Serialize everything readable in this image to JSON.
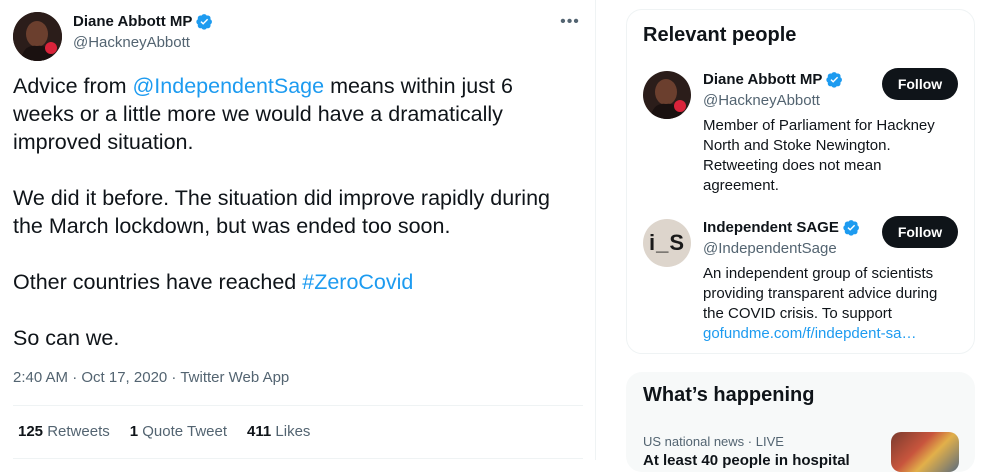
{
  "tweet": {
    "author_name": "Diane Abbott MP",
    "author_handle": "@HackneyAbbott",
    "more_icon": "more-horizontal-icon",
    "body": {
      "p1_before": "Advice from ",
      "p1_mention": "@IndependentSage",
      "p1_after": " means within just 6 weeks or a little more we would have a dramatically improved situation.",
      "p2": "We did it before. The situation did improve rapidly during the March lockdown, but was ended too soon.",
      "p3_before": "Other countries have reached ",
      "p3_hashtag": "#ZeroCovid",
      "p4": "So can we."
    },
    "meta": "2:40 AM · Oct 17, 2020 · Twitter Web App",
    "retweets_count": "125",
    "retweets_label": "Retweets",
    "quotes_count": "1",
    "quotes_label": "Quote Tweet",
    "likes_count": "411",
    "likes_label": "Likes"
  },
  "relevant_people": {
    "title": "Relevant people",
    "people": [
      {
        "name": "Diane Abbott MP",
        "handle": "@HackneyAbbott",
        "bio": "Member of Parliament for Hackney North and Stoke Newington. Retweeting does not mean agreement.",
        "follow_label": "Follow"
      },
      {
        "name": "Independent SAGE",
        "handle": "@IndependentSage",
        "bio_text": "An independent group of scientists providing transparent advice during the COVID crisis. To support",
        "bio_link": "gofundme.com/f/indepdent-sa…",
        "avatar_text": "i_S",
        "follow_label": "Follow"
      }
    ]
  },
  "whats_happening": {
    "title": "What’s happening",
    "trend_meta": "US national news · LIVE",
    "trend_text": "At least 40 people in hospital"
  },
  "colors": {
    "accent": "#1d9bf0",
    "text": "#0f1419",
    "muted": "#536471",
    "button_bg": "#0f1419"
  }
}
